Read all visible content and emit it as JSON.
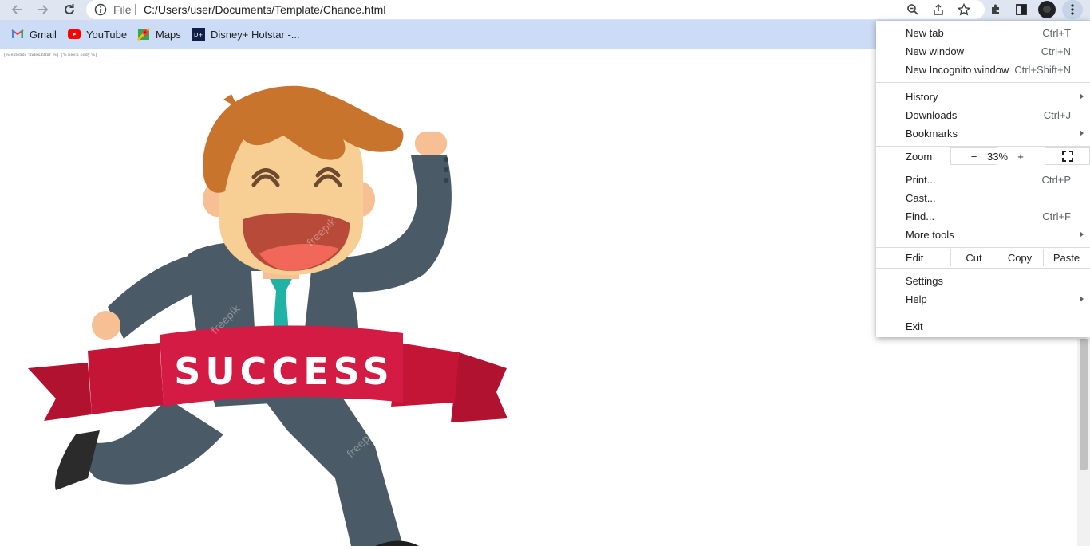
{
  "browser": {
    "back_icon": "arrow-left-icon",
    "forward_icon": "arrow-right-icon",
    "reload_icon": "reload-icon",
    "omnibox": {
      "scheme_label": "File",
      "url": "C:/Users/user/Documents/Template/Chance.html"
    },
    "accent": "#dfe6f2"
  },
  "bookmarks": [
    {
      "label": "Gmail",
      "icon": "gmail-icon"
    },
    {
      "label": "YouTube",
      "icon": "youtube-icon"
    },
    {
      "label": "Maps",
      "icon": "maps-icon"
    },
    {
      "label": "Disney+ Hotstar -...",
      "icon": "hotstar-icon"
    }
  ],
  "page": {
    "template_text": "{% extends 'index.html' %} {% block body %}",
    "banner_text": "SUCCESS",
    "watermark": "freepik"
  },
  "menu": {
    "new_tab": {
      "label": "New tab",
      "shortcut": "Ctrl+T"
    },
    "new_window": {
      "label": "New window",
      "shortcut": "Ctrl+N"
    },
    "incognito": {
      "label": "New Incognito window",
      "shortcut": "Ctrl+Shift+N"
    },
    "history": {
      "label": "History"
    },
    "downloads": {
      "label": "Downloads",
      "shortcut": "Ctrl+J"
    },
    "bookmarks": {
      "label": "Bookmarks"
    },
    "zoom": {
      "label": "Zoom",
      "minus": "−",
      "value": "33%",
      "plus": "+"
    },
    "print": {
      "label": "Print...",
      "shortcut": "Ctrl+P"
    },
    "cast": {
      "label": "Cast..."
    },
    "find": {
      "label": "Find...",
      "shortcut": "Ctrl+F"
    },
    "more_tools": {
      "label": "More tools"
    },
    "edit": {
      "label": "Edit",
      "cut": "Cut",
      "copy": "Copy",
      "paste": "Paste"
    },
    "settings": {
      "label": "Settings"
    },
    "help": {
      "label": "Help"
    },
    "exit": {
      "label": "Exit"
    }
  }
}
